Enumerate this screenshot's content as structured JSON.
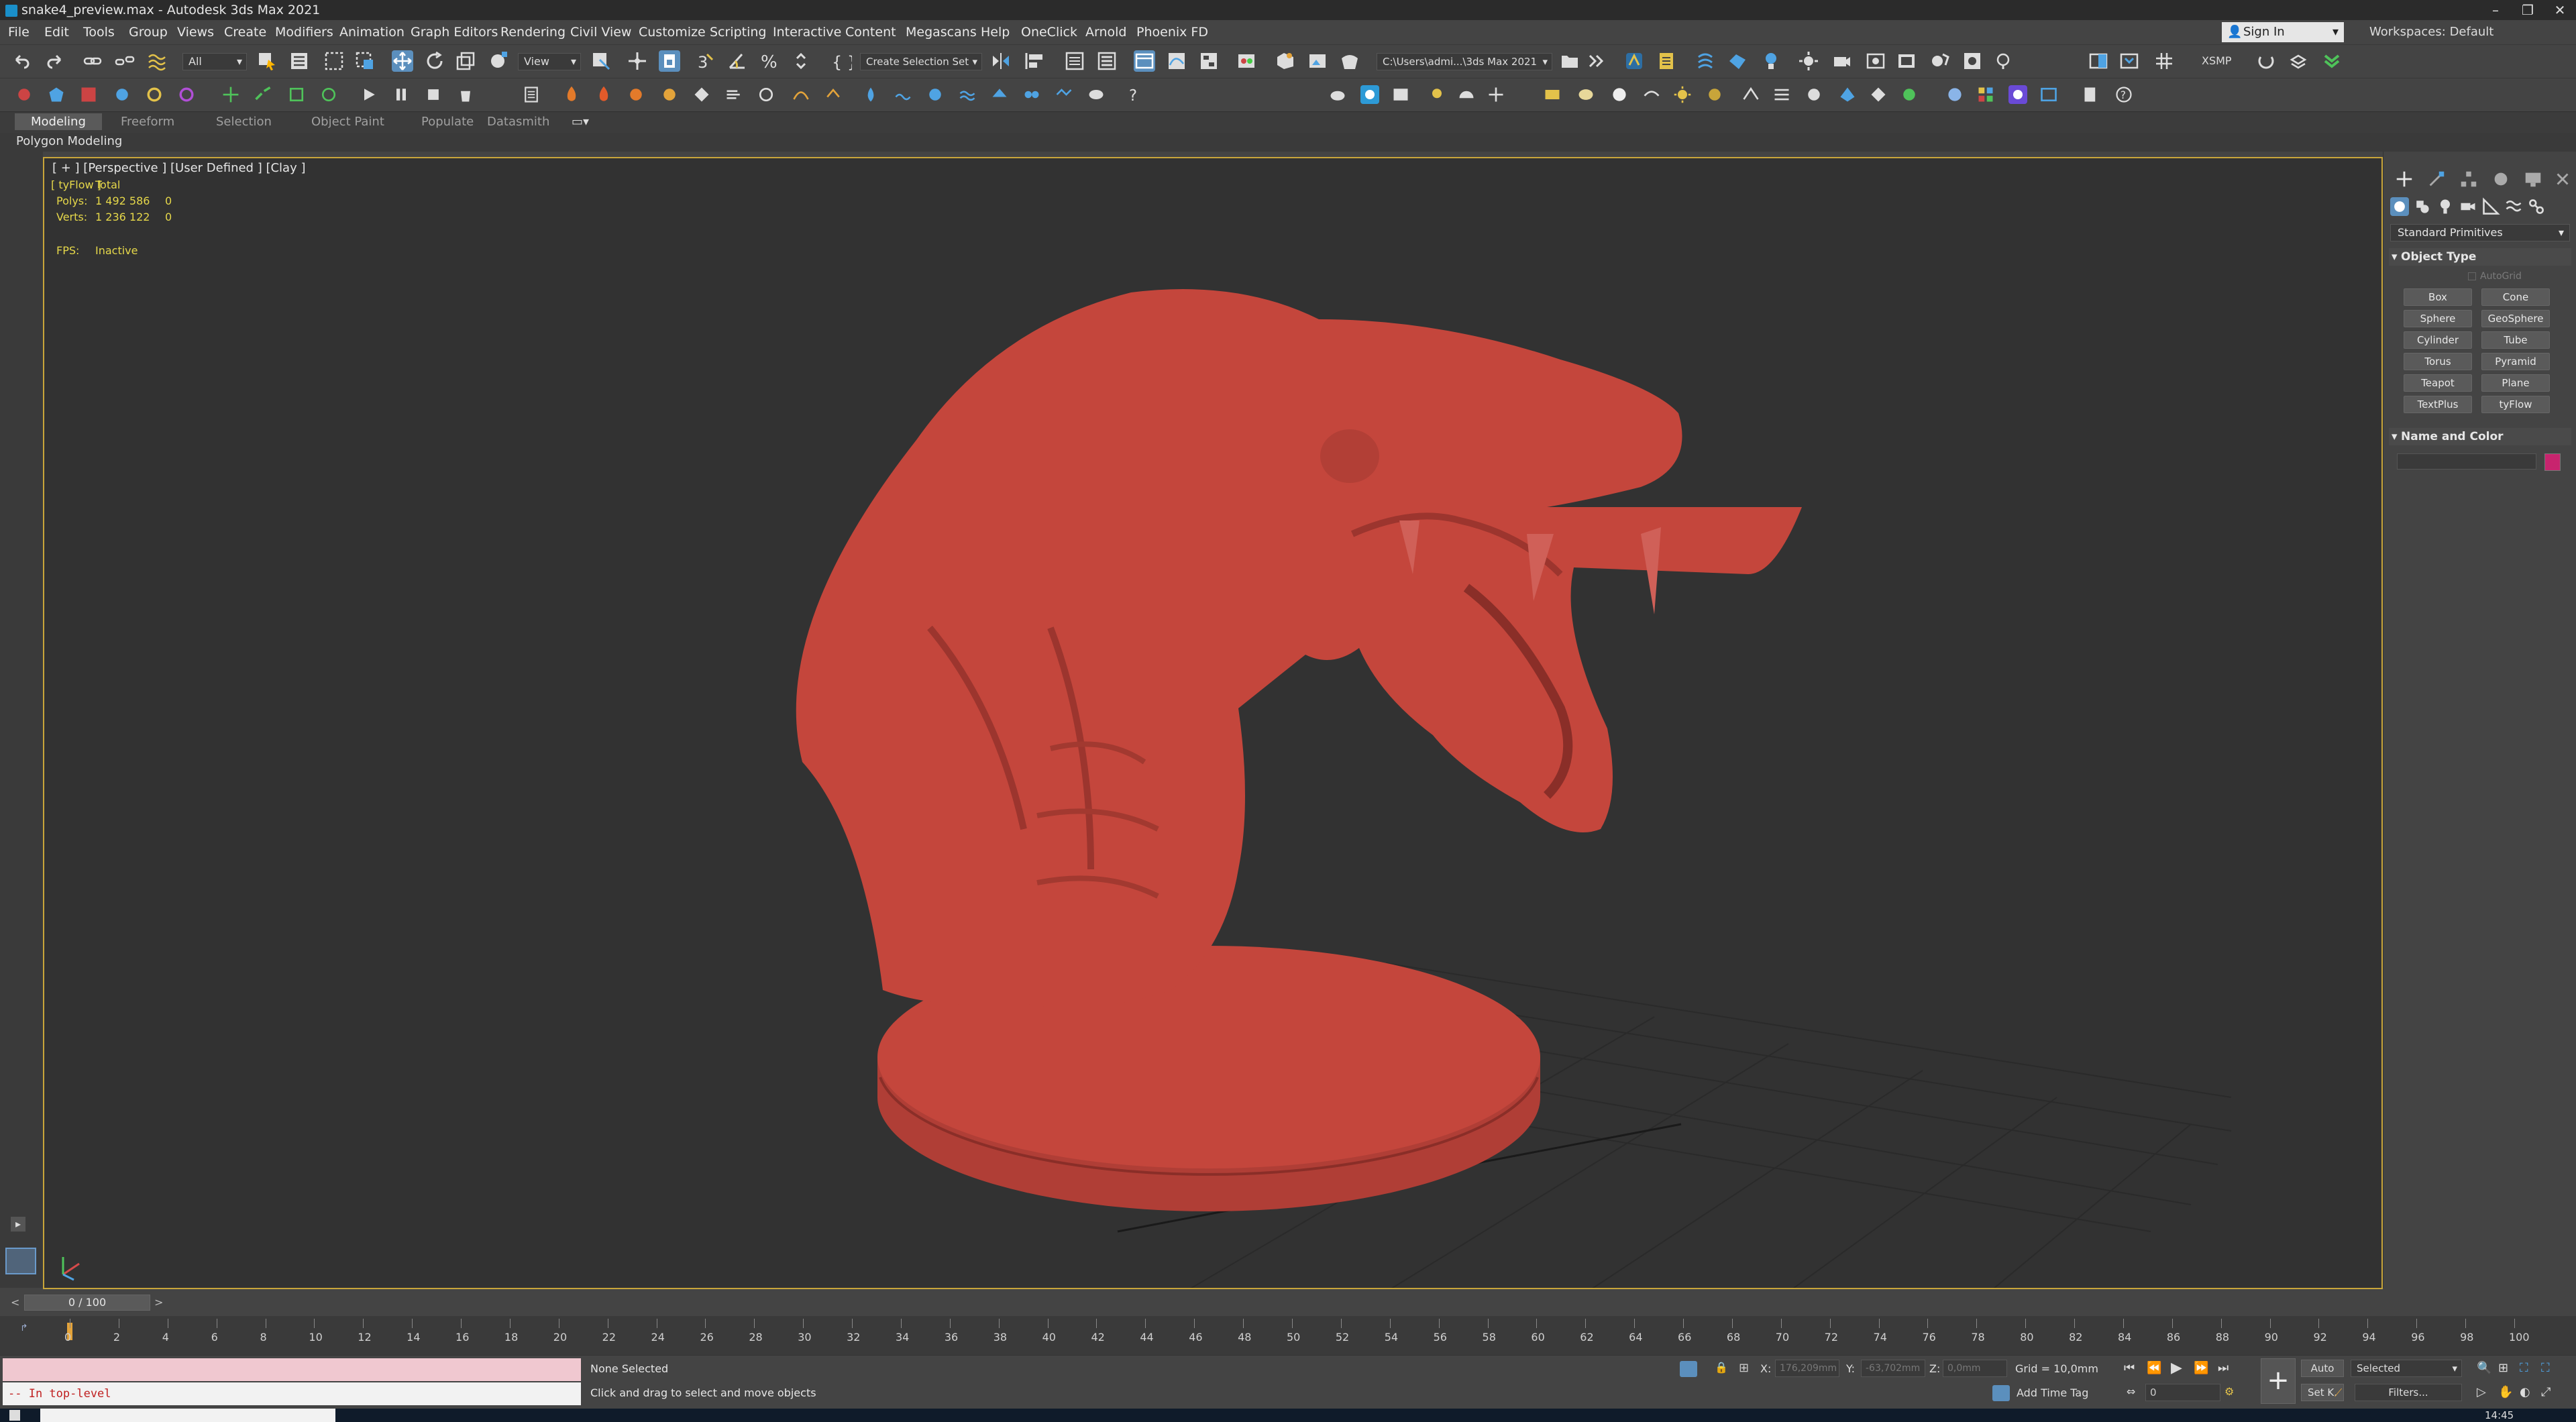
{
  "titlebar": {
    "title": "snake4_preview.max - Autodesk 3ds Max 2021",
    "minimize": "–",
    "restore": "❐",
    "close": "✕"
  },
  "menus": [
    "File",
    "Edit",
    "Tools",
    "Group",
    "Views",
    "Create",
    "Modifiers",
    "Animation",
    "Graph Editors",
    "Rendering",
    "Civil View",
    "Customize",
    "Scripting",
    "Interactive",
    "Content",
    "Megascans",
    "Help",
    "OneClick",
    "Arnold",
    "Phoenix FD"
  ],
  "signin": {
    "label": "Sign In"
  },
  "workspaces": {
    "label": "Workspaces:",
    "value": "Default"
  },
  "toolbar": {
    "selection_filter": "All",
    "ref_coord": "View",
    "named_selection": "Create Selection Set",
    "project_path": "C:\\Users\\admi...\\3ds Max 2021",
    "xsmp": "XSMP"
  },
  "ribbon": {
    "tabs": [
      "Modeling",
      "Freeform",
      "Selection",
      "Object Paint",
      "Populate",
      "Datasmith"
    ],
    "active": "Modeling",
    "subtab": "Polygon Modeling"
  },
  "viewport": {
    "label": "[ + ] [Perspective ] [User Defined ] [Clay ]",
    "stats_header_left": "[ tyFlow ]",
    "stats_header_right": "Total",
    "polys_label": "Polys:",
    "polys_total": "1 492 586",
    "polys_sel": "0",
    "verts_label": "Verts:",
    "verts_total": "1 236 122",
    "verts_sel": "0",
    "fps_label": "FPS:",
    "fps_value": "Inactive",
    "model_color": "#c4463c"
  },
  "command_panel": {
    "category": "Standard Primitives",
    "object_type_title": "Object Type",
    "autogrid": "AutoGrid",
    "buttons": [
      "Box",
      "Cone",
      "Sphere",
      "GeoSphere",
      "Cylinder",
      "Tube",
      "Torus",
      "Pyramid",
      "Teapot",
      "Plane",
      "TextPlus",
      "tyFlow"
    ],
    "name_color_title": "Name and Color",
    "object_name": "",
    "swatch_color": "#c8246e"
  },
  "timeslider": {
    "frame": "0 / 100"
  },
  "track": {
    "ticks": [
      "0",
      "2",
      "4",
      "6",
      "8",
      "10",
      "12",
      "14",
      "16",
      "18",
      "20",
      "22",
      "24",
      "26",
      "28",
      "30",
      "32",
      "34",
      "36",
      "38",
      "40",
      "42",
      "44",
      "46",
      "48",
      "50",
      "52",
      "54",
      "56",
      "58",
      "60",
      "62",
      "64",
      "66",
      "68",
      "70",
      "72",
      "74",
      "76",
      "78",
      "80",
      "82",
      "84",
      "86",
      "88",
      "90",
      "92",
      "94",
      "96",
      "98",
      "100"
    ]
  },
  "status": {
    "maxscript": "-- In top-level",
    "selection": "None Selected",
    "prompt": "Click and drag to select and move objects",
    "x_label": "X:",
    "x_value": "176,209mm",
    "y_label": "Y:",
    "y_value": "-63,702mm",
    "z_label": "Z:",
    "z_value": "0,0mm",
    "grid": "Grid = 10,0mm",
    "add_time_tag": "Add Time Tag",
    "auto": "Auto",
    "setkey": "Set K.",
    "key_filter": "Selected",
    "filters": "Filters...",
    "frame_value": "0",
    "clock": "14:45"
  }
}
